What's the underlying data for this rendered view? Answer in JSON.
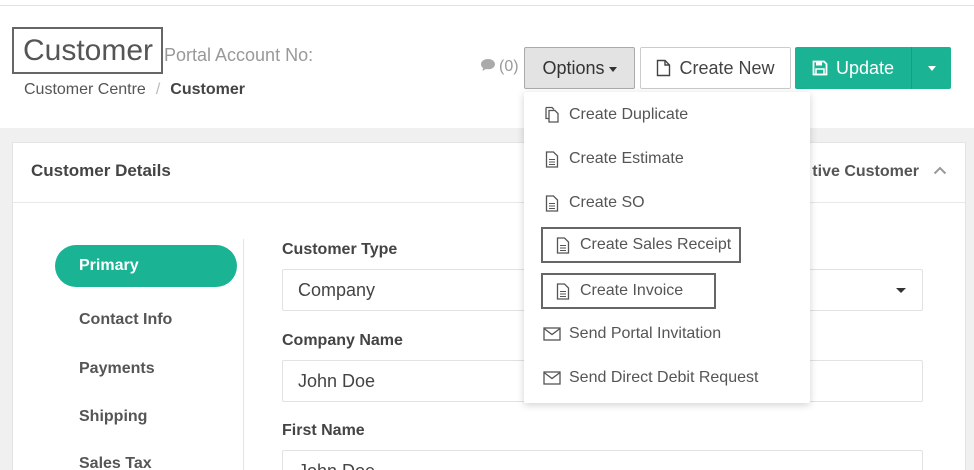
{
  "header": {
    "title": "Customer",
    "portal_label": "Portal Account No:",
    "breadcrumb": {
      "parent": "Customer Centre",
      "separator": "/",
      "current": "Customer"
    },
    "comments_count": "(0)",
    "options_label": "Options",
    "create_new_label": "Create New",
    "update_label": "Update"
  },
  "options_menu": {
    "items": [
      {
        "label": "Create Duplicate",
        "icon": "duplicate-icon"
      },
      {
        "label": "Create Estimate",
        "icon": "document-icon"
      },
      {
        "label": "Create SO",
        "icon": "document-icon"
      },
      {
        "label": "Create Sales Receipt",
        "icon": "document-icon"
      },
      {
        "label": "Create Invoice",
        "icon": "document-icon"
      },
      {
        "label": "Send Portal Invitation",
        "icon": "envelope-icon"
      },
      {
        "label": "Send Direct Debit Request",
        "icon": "envelope-icon"
      }
    ]
  },
  "panel": {
    "title": "Customer Details",
    "status_text": "tive Customer"
  },
  "nav": {
    "items": [
      {
        "label": "Primary",
        "active": true
      },
      {
        "label": "Contact Info"
      },
      {
        "label": "Payments"
      },
      {
        "label": "Shipping"
      },
      {
        "label": "Sales Tax"
      }
    ]
  },
  "form": {
    "customer_type_label": "Customer Type",
    "customer_type_value": "Company",
    "company_name_label": "Company Name",
    "company_name_value": "John Doe",
    "first_name_label": "First Name",
    "first_name_value": "John Doe"
  },
  "colors": {
    "accent": "#1ab394",
    "options_bg": "#e3e3e3"
  }
}
